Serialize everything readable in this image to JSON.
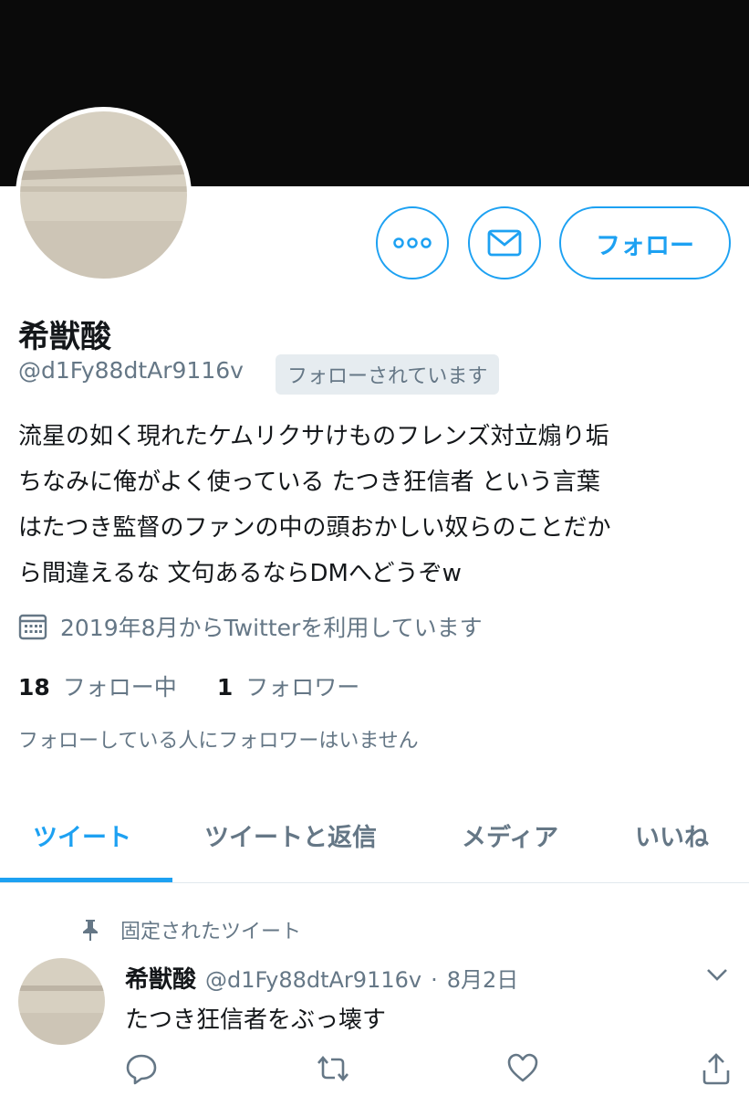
{
  "profile": {
    "name": "希獣酸",
    "handle": "@d1Fy88dtAr9116v",
    "follows_you_badge": "フォローされています",
    "bio_lines": [
      "流星の如く現れたケムリクサけものフレンズ対立煽り垢",
      "ちなみに俺がよく使っている たつき狂信者 という言葉",
      "はたつき監督のファンの中の頭おかしい奴らのことだか",
      "ら間違えるな 文句あるならDMへどうぞw"
    ],
    "joined": "2019年8月からTwitterを利用しています",
    "following_count": "18",
    "following_label": "フォロー中",
    "followers_count": "1",
    "followers_label": "フォロワー",
    "no_known_followers": "フォローしている人にフォロワーはいません"
  },
  "actions": {
    "follow_label": "フォロー",
    "more_icon": "more-icon",
    "message_icon": "mail-icon"
  },
  "tabs": [
    {
      "label": "ツイート",
      "active": true
    },
    {
      "label": "ツイートと返信",
      "active": false
    },
    {
      "label": "メディア",
      "active": false
    },
    {
      "label": "いいね",
      "active": false
    }
  ],
  "pinned_tweet": {
    "pinned_label": "固定されたツイート",
    "author_name": "希獣酸",
    "author_handle": "@d1Fy88dtAr9116v",
    "separator": "·",
    "date": "8月2日",
    "text": "たつき狂信者をぶっ壊す"
  },
  "colors": {
    "accent": "#1da1f2",
    "secondary_text": "#657786",
    "banner": "#0a0a0a"
  }
}
